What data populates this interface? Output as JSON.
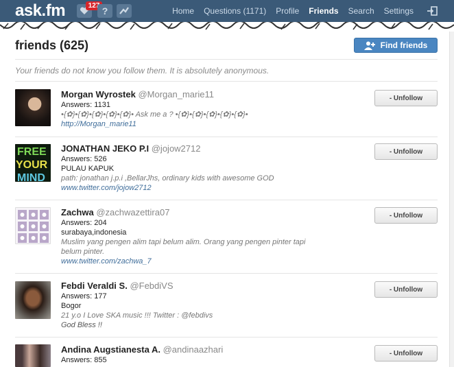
{
  "header": {
    "logo": "ask.fm",
    "notification_badge": "127",
    "nav": [
      {
        "label": "Home"
      },
      {
        "label": "Questions (1171)"
      },
      {
        "label": "Profile"
      },
      {
        "label": "Friends",
        "active": true
      },
      {
        "label": "Search"
      },
      {
        "label": "Settings"
      }
    ]
  },
  "page": {
    "title": "friends (625)",
    "find_button": "Find friends",
    "notice": "Your friends do not know you follow them. It is absolutely anonymous."
  },
  "friends": [
    {
      "name": "Morgan Wyrostek",
      "handle": "@Morgan_marie11",
      "answers": "Answers: 1131",
      "location": "",
      "bio": "•{✿}•{✿}•{✿}•{✿}•{✿}• Ask me a ? •{✿}•{✿}•{✿}•{✿}•{✿}•",
      "link": "http://Morgan_marie11",
      "button": "- Unfollow"
    },
    {
      "name": "JONATHAN JEKO P.I",
      "handle": "@jojow2712",
      "answers": "Answers: 526",
      "location": "PULAU KAPUK",
      "bio": "path: jonathan j.p.i ,BellarJhs, ordinary kids with awesome GOD",
      "link": "www.twitter.com/jojow2712",
      "button": "- Unfollow"
    },
    {
      "name": "Zachwa",
      "handle": "@zachwazettira07",
      "answers": "Answers: 204",
      "location": "surabaya,indonesia",
      "bio": "Muslim yang pengen alim tapi belum alim. Orang yang pengen pinter tapi belum pinter.",
      "link": "www.twitter.com/zachwa_7",
      "button": "- Unfollow"
    },
    {
      "name": "Febdi Veraldi S.",
      "handle": "@FebdiVS",
      "answers": "Answers: 177",
      "location": "Bogor",
      "bio": "21 y.o I Love SKA music !!! Twitter : @febdivs",
      "link": "God Bless !!",
      "button": "- Unfollow"
    },
    {
      "name": "Andina Augstianesta A.",
      "handle": "@andinaazhari",
      "answers": "Answers: 855",
      "location": "",
      "bio": "",
      "link": "",
      "button": "- Unfollow"
    }
  ],
  "colors": {
    "topbar": "#3b5a78",
    "primary_button": "#4a86c1",
    "badge": "#d8262b",
    "link": "#3f6d9a"
  }
}
